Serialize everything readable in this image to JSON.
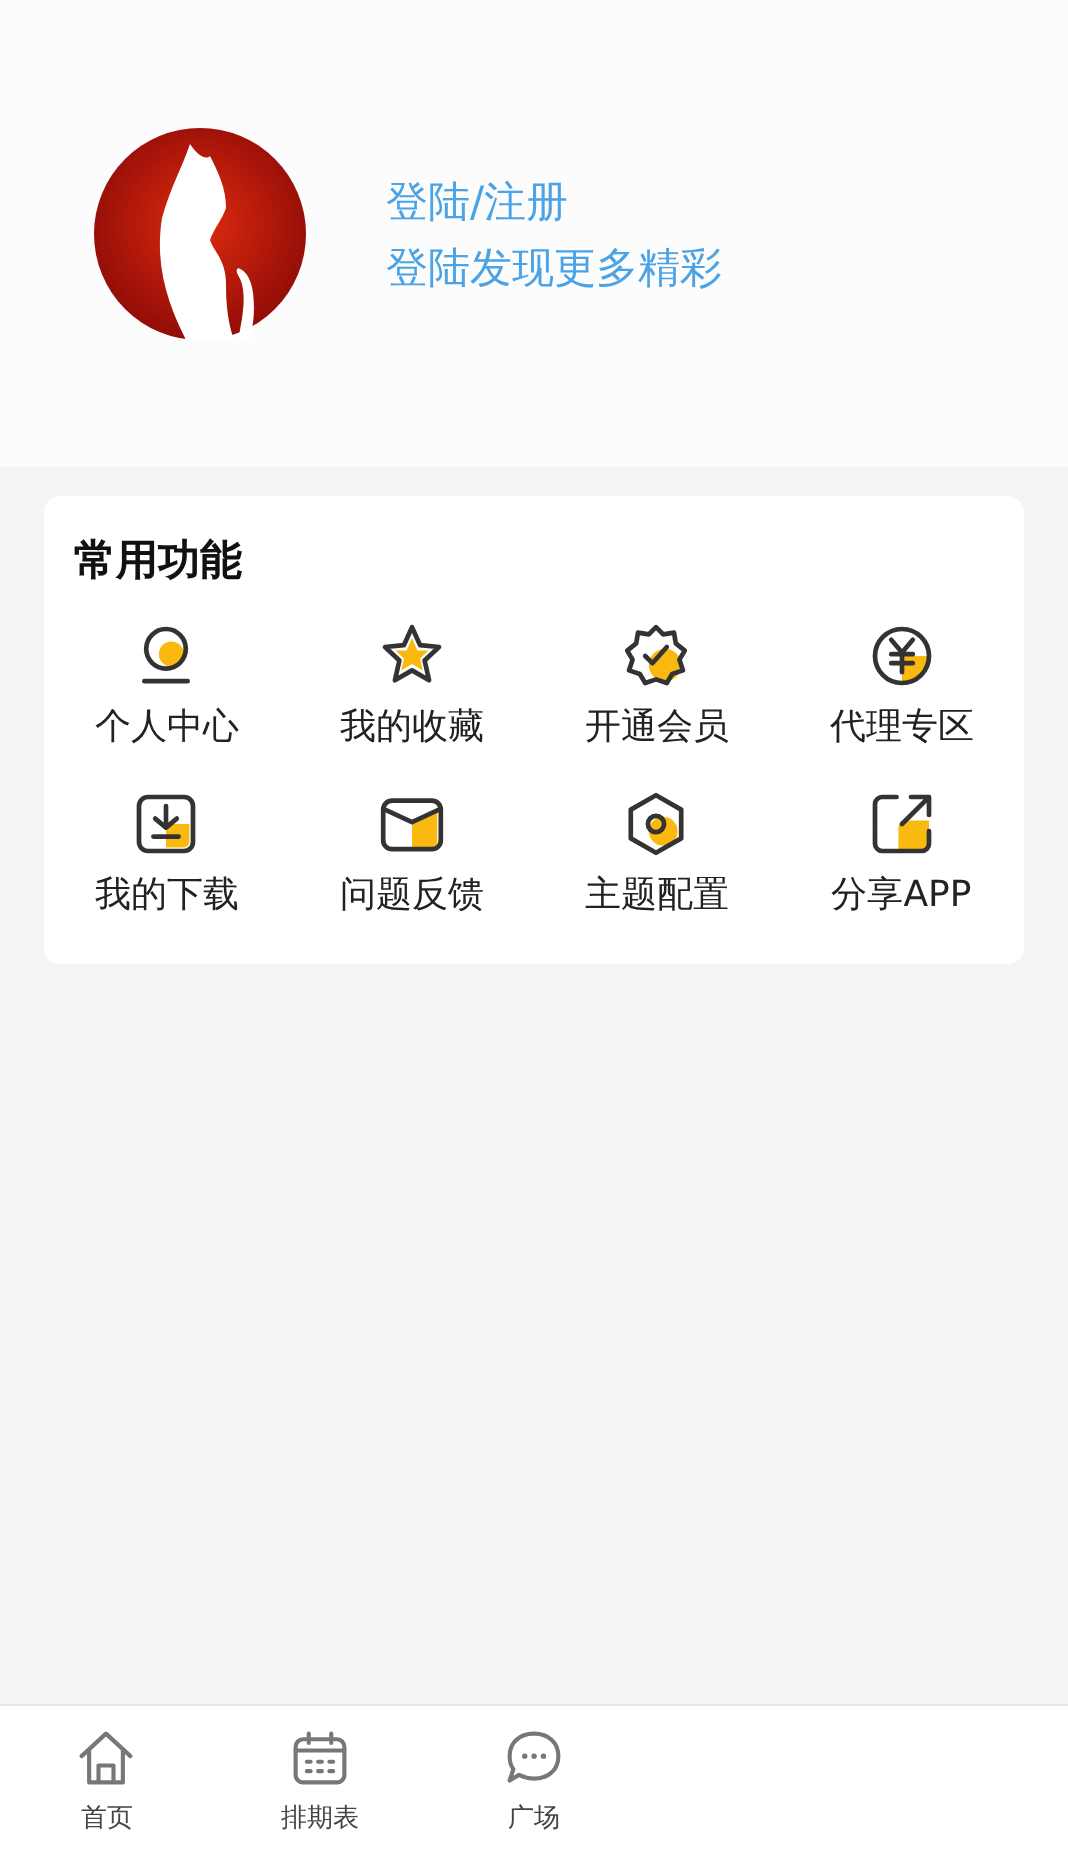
{
  "profile": {
    "title": "登陆/注册",
    "subtitle": "登陆发现更多精彩"
  },
  "functions": {
    "title": "常用功能",
    "items": [
      {
        "kind": "user",
        "label": "个人中心"
      },
      {
        "kind": "star",
        "label": "我的收藏"
      },
      {
        "kind": "badge",
        "label": "开通会员"
      },
      {
        "kind": "yen",
        "label": "代理专区"
      },
      {
        "kind": "download",
        "label": "我的下载"
      },
      {
        "kind": "mail",
        "label": "问题反馈"
      },
      {
        "kind": "hexagon",
        "label": "主题配置"
      },
      {
        "kind": "share",
        "label": "分享APP"
      }
    ]
  },
  "tab_bar": [
    {
      "kind": "home",
      "label": "首页"
    },
    {
      "kind": "calendar",
      "label": "排期表"
    },
    {
      "kind": "chat",
      "label": "广场"
    }
  ]
}
